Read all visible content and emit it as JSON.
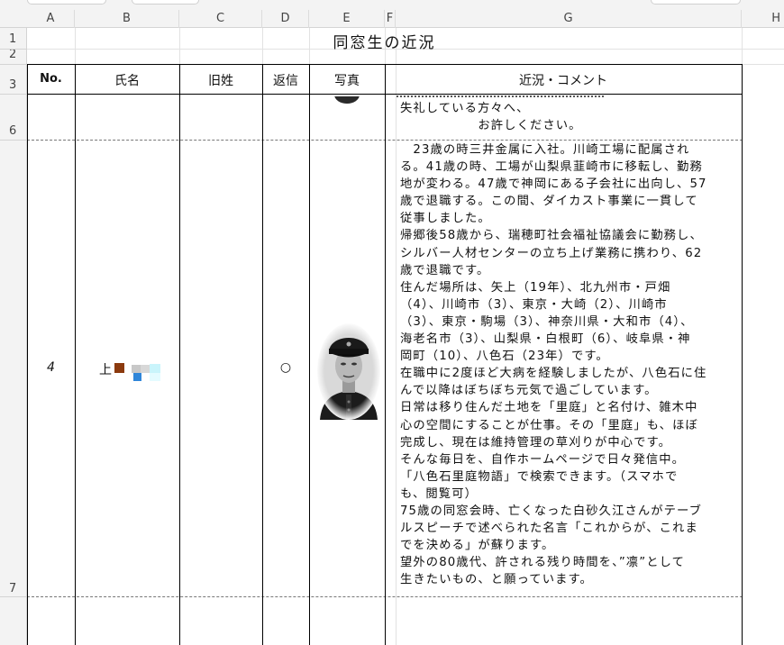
{
  "columns": {
    "A": "A",
    "B": "B",
    "C": "C",
    "D": "D",
    "E": "E",
    "F": "F",
    "G": "G",
    "H": "H"
  },
  "rows": {
    "r1": "1",
    "r2": "2",
    "r3": "3",
    "r6": "6",
    "r7": "7"
  },
  "sheet": {
    "title": "同窓生の近況",
    "headers": {
      "no": "No.",
      "name": "氏名",
      "maiden": "旧姓",
      "reply": "返信",
      "photo": "写真",
      "comment": "近況・コメント"
    },
    "row6_comment_lines": [
      "失礼している方々へ、",
      "　　　　　　お許しください。"
    ],
    "entry": {
      "no": "4",
      "name_prefix": "上",
      "reply": "○",
      "comment_lines": [
        "　23歳の時三井金属に入社。川崎工場に配属され",
        "る。41歳の時、工場が山梨県韮崎市に移転し、勤務",
        "地が変わる。47歳で神岡にある子会社に出向し、57",
        "歳で退職する。この間、ダイカスト事業に一貫して",
        "従事しました。",
        "帰郷後58歳から、瑞穂町社会福祉協議会に勤務し、",
        "シルバー人材センターの立ち上げ業務に携わり、62",
        "歳で退職です。",
        "住んだ場所は、矢上（19年）、北九州市・戸畑",
        "（4）、川崎市（3）、東京・大崎（2）、川崎市",
        "（3）、東京・駒場（3）、神奈川県・大和市（4）、",
        "海老名市（3）、山梨県・白根町（6）、岐阜県・神",
        "岡町（10）、八色石（23年）です。",
        "在職中に2度ほど大病を経験しましたが、八色石に住",
        "んで以降はぼちぼち元気で過ごしています。",
        "日常は移り住んだ土地を「里庭」と名付け、雑木中",
        "心の空間にすることが仕事。その「里庭」も、ほぼ",
        "完成し、現在は維持管理の草刈りが中心です。",
        "そんな毎日を、自作ホームページで日々発信中。",
        "「八色石里庭物語」で検索できます。（スマホで",
        "も、閲覧可）",
        "75歳の同窓会時、亡くなった白砂久江さんがテーブ",
        "ルスピーチで述べられた名言「これからが、これま",
        "でを決める」が蘇ります。",
        "望外の80歳代、許される残り時間を、”凛”として",
        "生きたいもの、と願っています。"
      ]
    }
  },
  "colors": {
    "redaction_red": "#8b3a0e",
    "redaction_blue": "#2f86d9",
    "redaction_cyan": "#c9f4fb",
    "redaction_gray": "#c8c8c8"
  }
}
